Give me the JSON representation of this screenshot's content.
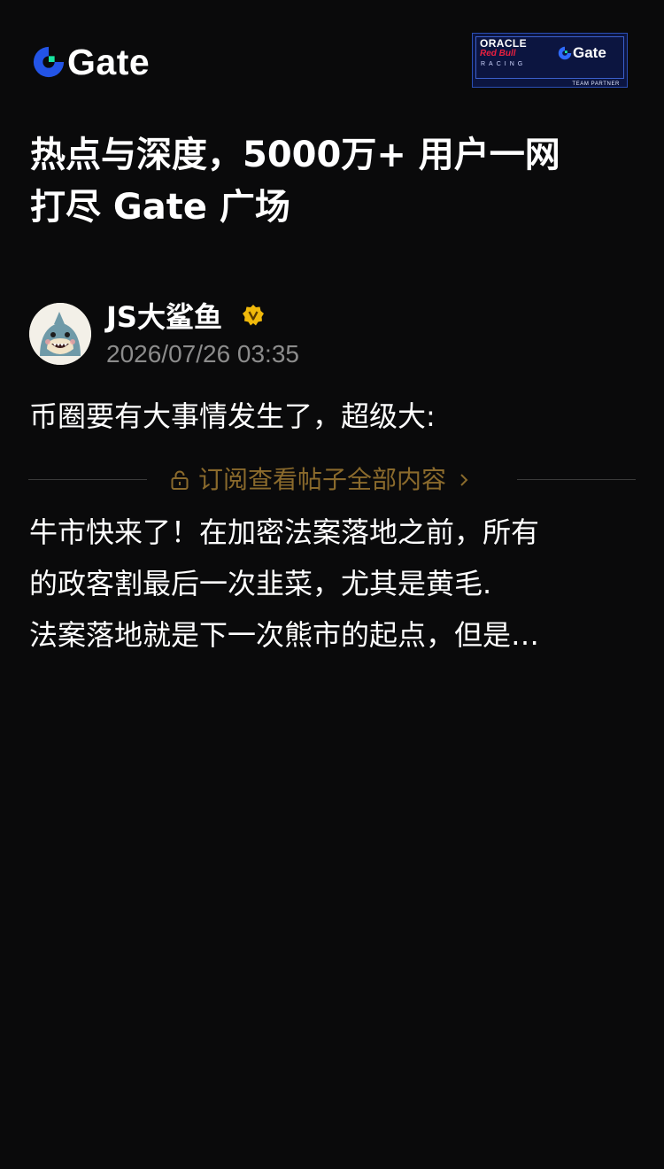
{
  "brand": {
    "name": "Gate"
  },
  "partner_badge": {
    "oracle": "ORACLE",
    "redbull": "Red Bull",
    "racing": "RACING",
    "gate": "Gate",
    "team_partner": "TEAM PARTNER"
  },
  "headline": {
    "line1": "热点与深度，5000万+ 用户一网",
    "line2": "打尽 Gate 广场"
  },
  "post": {
    "author": "JS大鲨鱼",
    "time": "2026/07/26 03:35",
    "text": "币圈要有大事情发生了，超级大:",
    "subscribe_label": "订阅查看帖子全部内容",
    "preview_lines": [
      "牛市快来了！在加密法案落地之前，所有",
      "的政客割最后一次韭菜，尤其是黄毛.",
      "法案落地就是下一次熊市的起点，但是…"
    ]
  },
  "colors": {
    "background": "#0a0a0b",
    "brand_blue": "#2354e6",
    "brand_green": "#17e6a1",
    "verified_gold": "#f0b90b",
    "subscribe_gold": "#8a6a2c",
    "muted_text": "#8c8c8c"
  },
  "icons": [
    "gate-logo-icon",
    "verified-badge-icon",
    "lock-icon",
    "chevron-right-icon"
  ]
}
